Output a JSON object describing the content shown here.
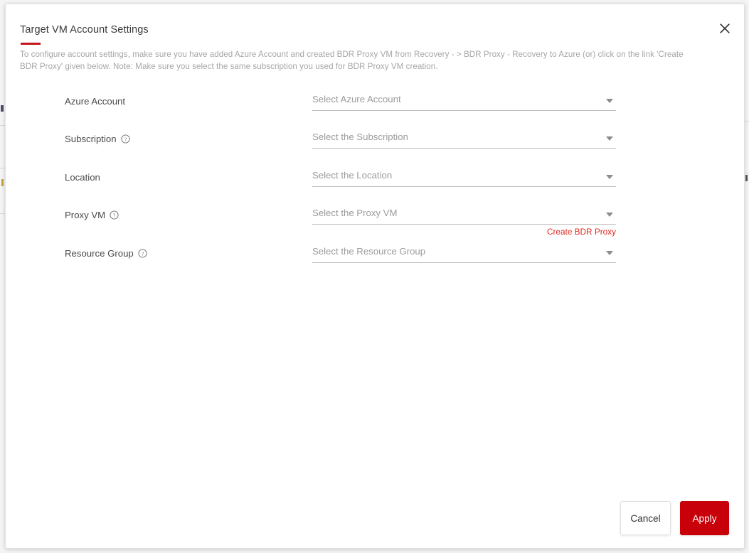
{
  "modal": {
    "title": "Target VM Account Settings",
    "description": "To configure account settings, make sure you have added Azure Account and created BDR Proxy VM from Recovery - > BDR Proxy - Recovery to Azure (or) click on the link 'Create BDR Proxy' given below. Note: Make sure you select the same subscription you used for BDR Proxy VM creation.",
    "close_icon": "close-icon",
    "accent_color": "#c4161c"
  },
  "form": {
    "rows": [
      {
        "label": "Azure Account",
        "has_help": false,
        "placeholder": "Select Azure Account",
        "caret_icon": "chevron-down-icon",
        "field_name": "azure-account"
      },
      {
        "label": "Subscription",
        "has_help": true,
        "help_icon": "help-circle-icon",
        "placeholder": "Select the Subscription",
        "caret_icon": "chevron-down-icon",
        "field_name": "subscription"
      },
      {
        "label": "Location",
        "has_help": false,
        "placeholder": "Select the Location",
        "caret_icon": "chevron-down-icon",
        "field_name": "location"
      },
      {
        "label": "Proxy VM",
        "has_help": true,
        "help_icon": "help-circle-icon",
        "placeholder": "Select the Proxy VM",
        "caret_icon": "chevron-down-icon",
        "field_name": "proxy-vm",
        "link": "Create BDR Proxy",
        "link_color": "#e02b20"
      },
      {
        "label": "Resource Group",
        "has_help": true,
        "help_icon": "help-circle-icon",
        "placeholder": "Select the Resource Group",
        "caret_icon": "chevron-down-icon",
        "field_name": "resource-group"
      }
    ]
  },
  "footer": {
    "cancel_label": "Cancel",
    "apply_label": "Apply",
    "apply_color": "#c8000a"
  }
}
